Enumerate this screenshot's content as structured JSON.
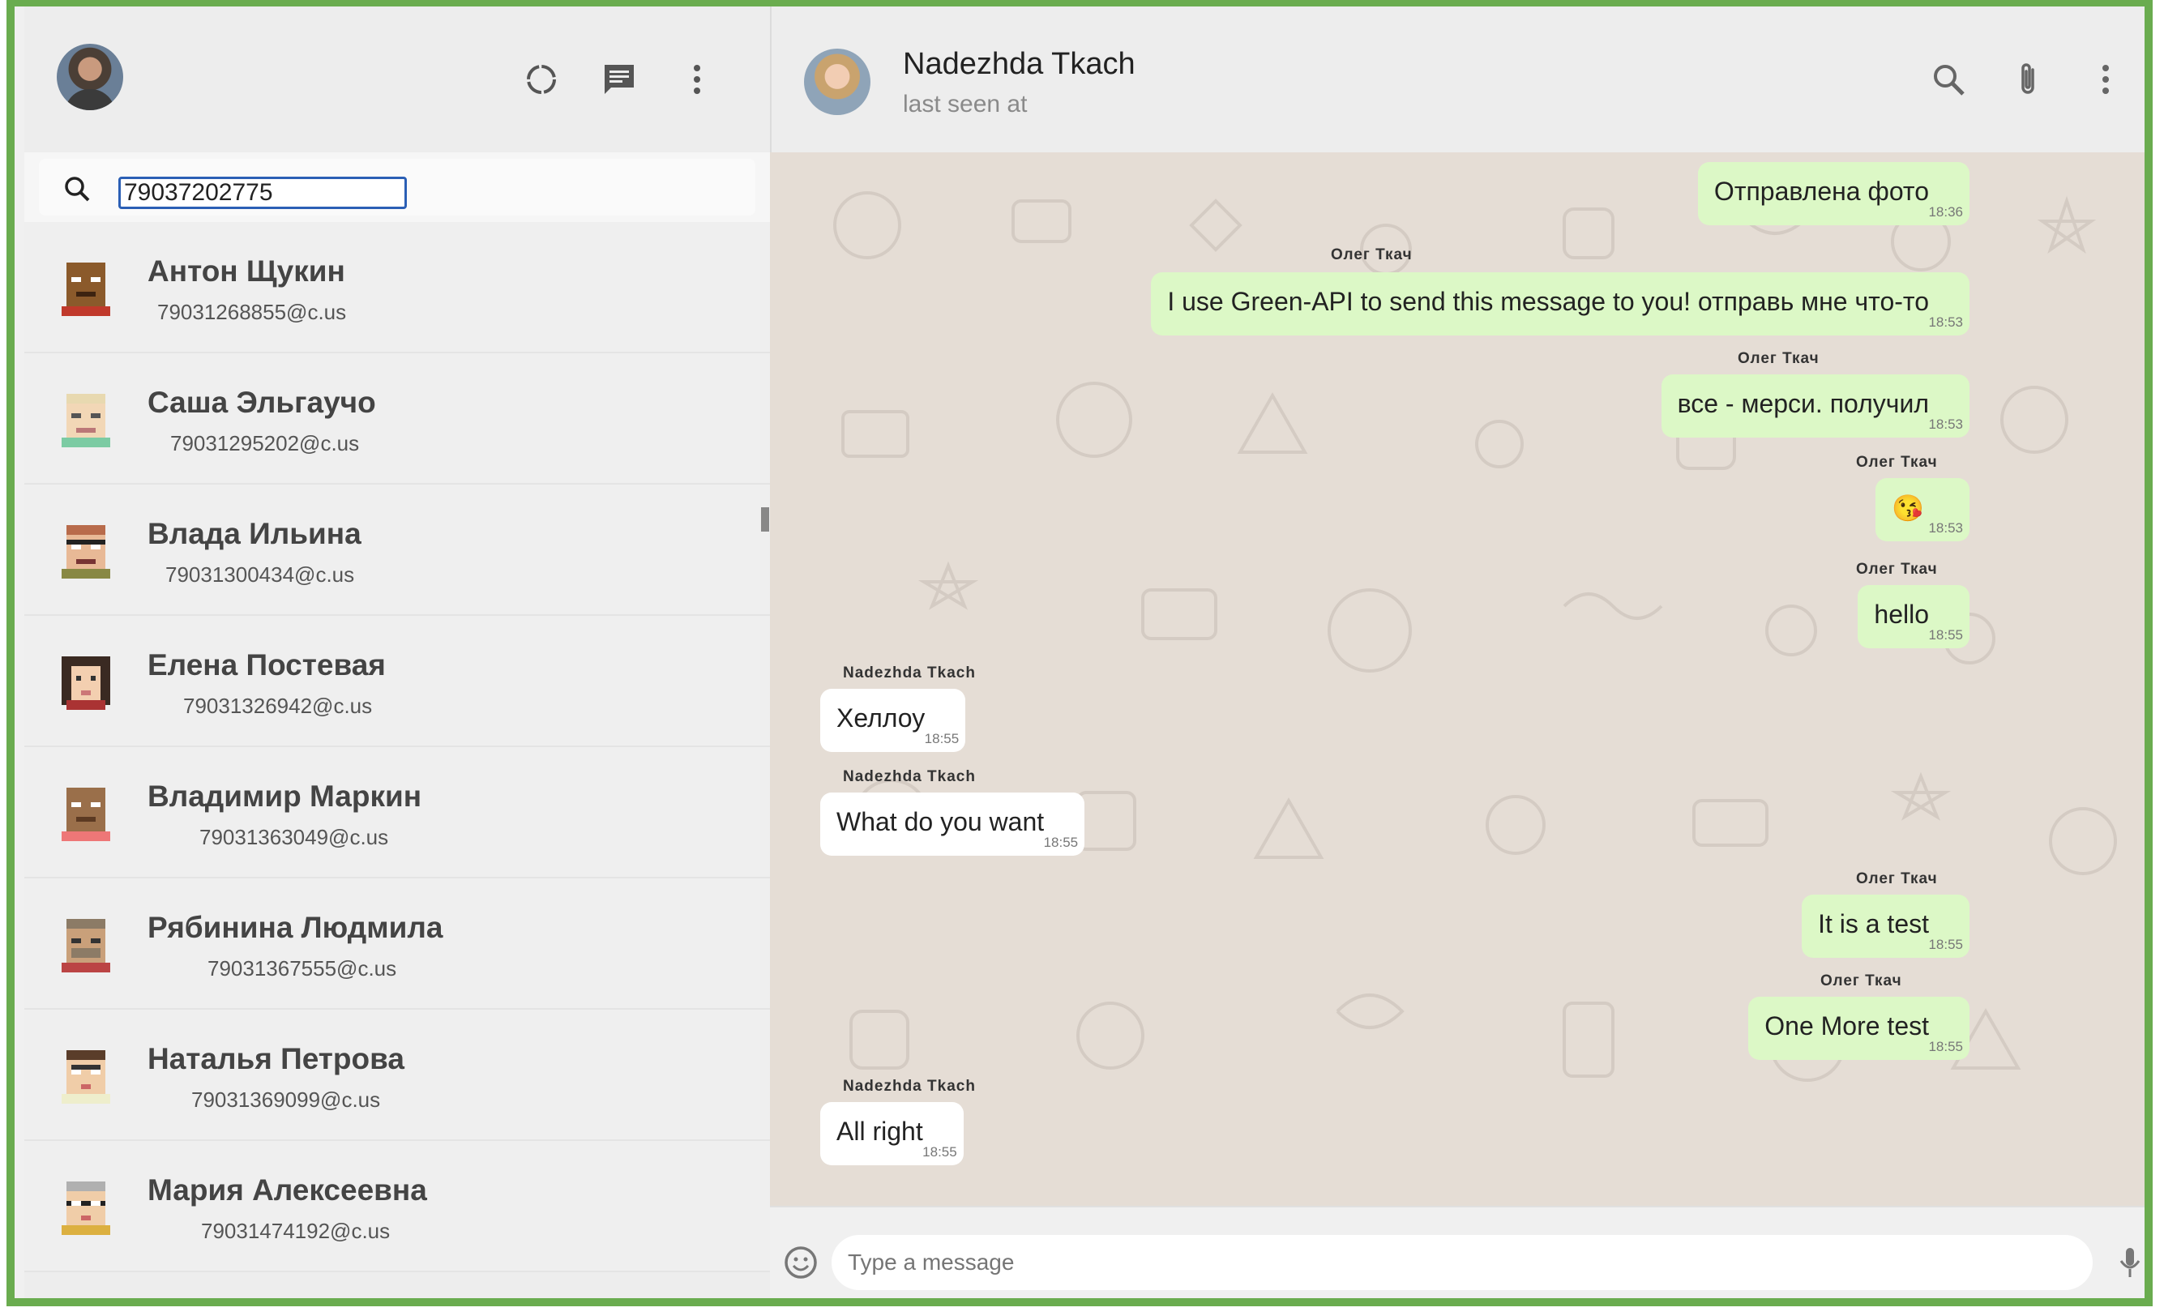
{
  "left": {
    "search": {
      "value": "79037202775",
      "placeholder": ""
    },
    "contacts": [
      {
        "name": "Антон Щукин",
        "id": "79031268855@c.us",
        "avatar_color": "#8b5a2b"
      },
      {
        "name": "Саша Эльгаучо",
        "id": "79031295202@c.us",
        "avatar_color": "#e8d9b0"
      },
      {
        "name": "Влада Ильина",
        "id": "79031300434@c.us",
        "avatar_color": "#b86b4b"
      },
      {
        "name": "Елена Постевая",
        "id": "79031326942@c.us",
        "avatar_color": "#3a2a22"
      },
      {
        "name": "Владимир Маркин",
        "id": "79031363049@c.us",
        "avatar_color": "#9a6f4a"
      },
      {
        "name": "Рябинина Людмила",
        "id": "79031367555@c.us",
        "avatar_color": "#8c7b66"
      },
      {
        "name": "Наталья Петрова",
        "id": "79031369099@c.us",
        "avatar_color": "#5a3d2a"
      },
      {
        "name": "Мария Алексеевна",
        "id": "79031474192@c.us",
        "avatar_color": "#b0b0b0"
      }
    ]
  },
  "chat": {
    "peer_name": "Nadezhda Tkach",
    "peer_status": "last seen at",
    "messages": [
      {
        "sender": "Олег Ткач",
        "text": "Отправлена фото",
        "time": "18:36",
        "direction": "out"
      },
      {
        "sender": "Олег Ткач",
        "text": "I use Green-API to send this message to you! отправь мне что-то",
        "time": "18:53",
        "direction": "out"
      },
      {
        "sender": "Олег Ткач",
        "text": "все - мерси. получил",
        "time": "18:53",
        "direction": "out"
      },
      {
        "sender": "Олег Ткач",
        "text": "😘",
        "time": "18:53",
        "direction": "out"
      },
      {
        "sender": "Олег Ткач",
        "text": "hello",
        "time": "18:55",
        "direction": "out"
      },
      {
        "sender": "Nadezhda Tkach",
        "text": "Хеллоу",
        "time": "18:55",
        "direction": "in"
      },
      {
        "sender": "Nadezhda Tkach",
        "text": "What do you want",
        "time": "18:55",
        "direction": "in"
      },
      {
        "sender": "Олег Ткач",
        "text": "It is a test",
        "time": "18:55",
        "direction": "out"
      },
      {
        "sender": "Олег Ткач",
        "text": "One More test",
        "time": "18:55",
        "direction": "out"
      },
      {
        "sender": "Nadezhda Tkach",
        "text": "All right",
        "time": "18:55",
        "direction": "in"
      }
    ],
    "composer_placeholder": "Type a message"
  },
  "icons": {
    "status": "status-icon",
    "new_chat": "chat-icon",
    "menu": "menu-icon",
    "search": "search-icon",
    "attach": "paperclip-icon",
    "emoji": "emoji-icon",
    "mic": "mic-icon"
  },
  "colors": {
    "frame": "#6aac4f",
    "bubble_out": "#dcf8c6",
    "bubble_in": "#ffffff",
    "chat_bg": "#e5ddd5"
  }
}
